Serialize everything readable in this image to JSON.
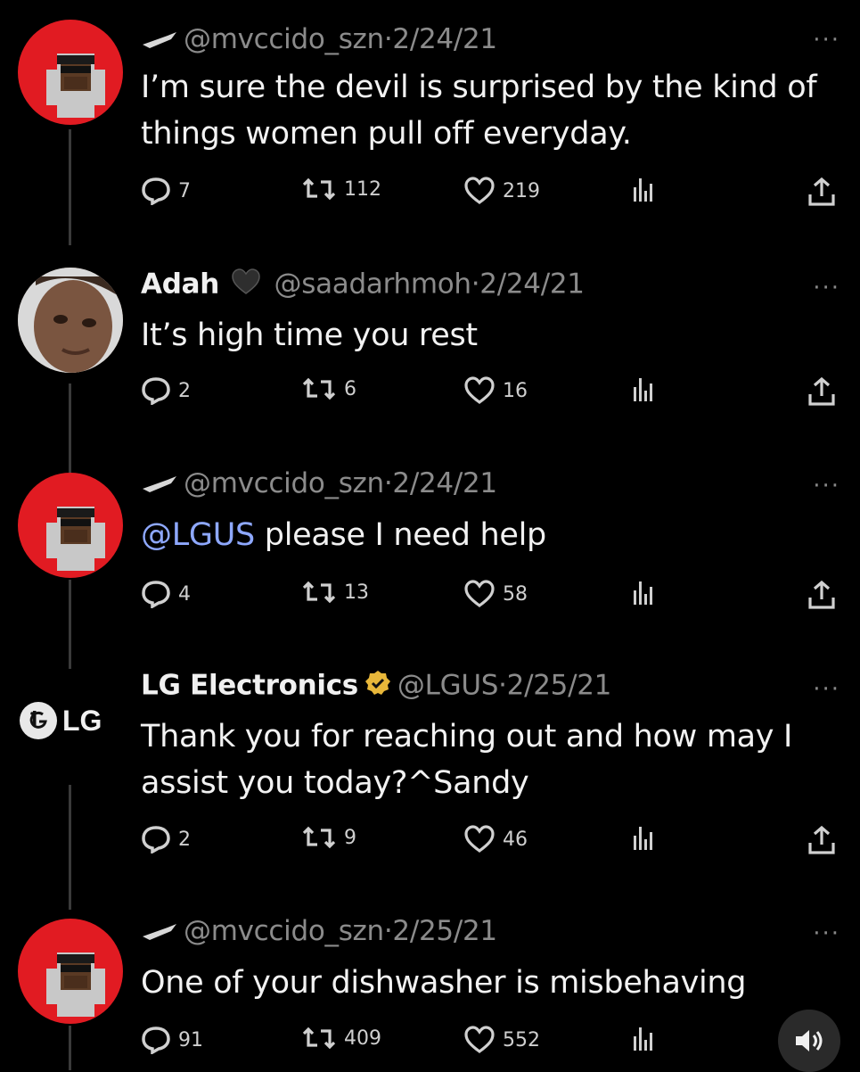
{
  "tweets": [
    {
      "author_name": "",
      "handle": "@mvccido_szn",
      "date": "2/24/21",
      "separator": "·",
      "text": "I’m sure the devil is surprised by the kind of things women pull off everyday.",
      "mention": "",
      "replies": "7",
      "retweets": "112",
      "likes": "219",
      "more": "···"
    },
    {
      "author_name": "Adah",
      "handle": "@saadarhmoh",
      "date": "2/24/21",
      "separator": "·",
      "text": "It’s high time you rest",
      "mention": "",
      "replies": "2",
      "retweets": "6",
      "likes": "16",
      "more": "···"
    },
    {
      "author_name": "",
      "handle": "@mvccido_szn",
      "date": "2/24/21",
      "separator": "·",
      "mention": "@LGUS",
      "text": " please I need help",
      "replies": "4",
      "retweets": "13",
      "likes": "58",
      "more": "···"
    },
    {
      "author_name": "LG Electronics",
      "handle": "@LGUS",
      "date": "2/25/21",
      "separator": "·",
      "text": "Thank you for reaching out and how may I assist you today?^Sandy",
      "mention": "",
      "replies": "2",
      "retweets": "9",
      "likes": "46",
      "more": "···",
      "logo_text": "LG"
    },
    {
      "author_name": "",
      "handle": "@mvccido_szn",
      "date": "2/25/21",
      "separator": "·",
      "text": "One of your dishwasher is misbehaving",
      "mention": "",
      "replies": "91",
      "retweets": "409",
      "likes": "552",
      "more": "···"
    }
  ],
  "colors": {
    "background": "#000000",
    "avatar_red": "#e11b22",
    "mention_blue": "#8ea8ff",
    "verified_gold": "#e8b73a"
  }
}
